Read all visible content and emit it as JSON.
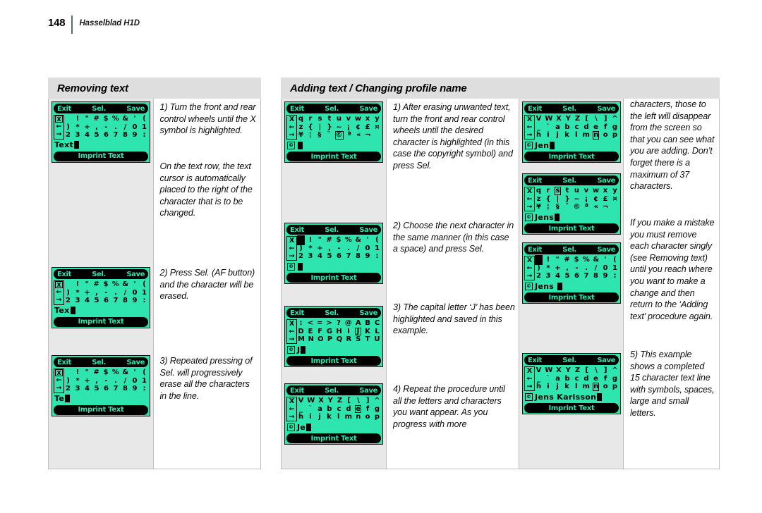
{
  "header": {
    "page_number": "148",
    "title": "Hasselblad H1D"
  },
  "sections": {
    "left": {
      "title": "Removing text"
    },
    "right": {
      "title": "Adding text / Changing profile name"
    }
  },
  "lcd_labels": {
    "exit": "Exit",
    "sel": "Sel.",
    "save": "Save",
    "imprint": "Imprint Text",
    "arrow_x": "X",
    "arrow_left": "←",
    "arrow_right": "→",
    "copyright_prefix": "©"
  },
  "screens": {
    "l1": {
      "name": "removing-text-screen-1",
      "arrow_top_boxed": true,
      "rows": [
        [
          "",
          "!",
          "\"",
          "#",
          "$",
          "%",
          "&",
          "'",
          "("
        ],
        [
          ")",
          "*",
          "+",
          ",",
          "-",
          ".",
          "/",
          "0",
          "1"
        ],
        [
          "2",
          "3",
          "4",
          "5",
          "6",
          "7",
          "8",
          "9",
          ":"
        ]
      ],
      "selected": null,
      "text_prefix": "",
      "text_value": "Text",
      "cursor": true
    },
    "l2": {
      "name": "removing-text-screen-2",
      "arrow_top_boxed": true,
      "rows": [
        [
          "",
          "!",
          "\"",
          "#",
          "$",
          "%",
          "&",
          "'",
          "("
        ],
        [
          ")",
          "*",
          "+",
          ",",
          "-",
          ".",
          "/",
          "0",
          "1"
        ],
        [
          "2",
          "3",
          "4",
          "5",
          "6",
          "7",
          "8",
          "9",
          ":"
        ]
      ],
      "selected": null,
      "text_prefix": "",
      "text_value": "Tex",
      "cursor": true
    },
    "l3": {
      "name": "removing-text-screen-3",
      "arrow_top_boxed": true,
      "rows": [
        [
          "",
          "!",
          "\"",
          "#",
          "$",
          "%",
          "&",
          "'",
          "("
        ],
        [
          ")",
          "*",
          "+",
          ",",
          "-",
          ".",
          "/",
          "0",
          "1"
        ],
        [
          "2",
          "3",
          "4",
          "5",
          "6",
          "7",
          "8",
          "9",
          ":"
        ]
      ],
      "selected": null,
      "text_prefix": "",
      "text_value": "Te",
      "cursor": true
    },
    "m1": {
      "name": "adding-text-screen-1",
      "arrow_top_boxed": false,
      "rows": [
        [
          "q",
          "r",
          "s",
          "t",
          "u",
          "v",
          "w",
          "x",
          "y"
        ],
        [
          "z",
          "{",
          "|",
          "}",
          "~",
          "¡",
          "¢",
          "£",
          "¤"
        ],
        [
          "¥",
          "¦",
          "§",
          "¨",
          "©",
          "ª",
          "«",
          "¬",
          ""
        ]
      ],
      "selected": [
        2,
        4
      ],
      "text_prefix": "©",
      "text_value": "",
      "cursor": true
    },
    "m2": {
      "name": "adding-text-screen-2",
      "arrow_top_boxed": false,
      "rows": [
        [
          " ",
          "!",
          "\"",
          "#",
          "$",
          "%",
          "&",
          "'",
          "("
        ],
        [
          ")",
          "*",
          "+",
          ",",
          "-",
          ".",
          "/",
          "0",
          "1"
        ],
        [
          "2",
          "3",
          "4",
          "5",
          "6",
          "7",
          "8",
          "9",
          ":"
        ]
      ],
      "selected": [
        0,
        0
      ],
      "text_prefix": "©",
      "text_value": "",
      "cursor": true
    },
    "m3": {
      "name": "adding-text-screen-3",
      "arrow_top_boxed": false,
      "rows": [
        [
          ":",
          "<",
          "=",
          ">",
          "?",
          "@",
          "A",
          "B",
          "C"
        ],
        [
          "D",
          "E",
          "F",
          "G",
          "H",
          "I",
          "J",
          "K",
          "L"
        ],
        [
          "M",
          "N",
          "O",
          "P",
          "Q",
          "R",
          "S",
          "T",
          "U"
        ]
      ],
      "selected": [
        1,
        6
      ],
      "text_prefix": "©",
      "text_value": "J",
      "cursor": true
    },
    "m4": {
      "name": "adding-text-screen-4",
      "arrow_top_boxed": false,
      "rows": [
        [
          "V",
          "W",
          "X",
          "Y",
          "Z",
          "[",
          "\\",
          "]",
          "^"
        ],
        [
          "_",
          "`",
          "a",
          "b",
          "c",
          "d",
          "e",
          "f",
          "g"
        ],
        [
          "h",
          "i",
          "j",
          "k",
          "l",
          "m",
          "n",
          "o",
          "p"
        ]
      ],
      "selected": [
        1,
        6
      ],
      "text_prefix": "©",
      "text_value": "Je",
      "cursor": true
    },
    "r1": {
      "name": "adding-text-screen-5",
      "arrow_top_boxed": false,
      "rows": [
        [
          "V",
          "W",
          "X",
          "Y",
          "Z",
          "[",
          "\\",
          "]",
          "^"
        ],
        [
          "_",
          "`",
          "a",
          "b",
          "c",
          "d",
          "e",
          "f",
          "g"
        ],
        [
          "h",
          "i",
          "j",
          "k",
          "l",
          "m",
          "n",
          "o",
          "p"
        ]
      ],
      "selected": [
        2,
        6
      ],
      "text_prefix": "©",
      "text_value": "Jen",
      "cursor": true
    },
    "r2": {
      "name": "adding-text-screen-6",
      "arrow_top_boxed": false,
      "rows": [
        [
          "q",
          "r",
          "s",
          "t",
          "u",
          "v",
          "w",
          "x",
          "y"
        ],
        [
          "z",
          "{",
          "|",
          "}",
          "~",
          "¡",
          "¢",
          "£",
          "¤"
        ],
        [
          "¥",
          "¦",
          "§",
          "¨",
          "©",
          "ª",
          "«",
          "¬",
          ""
        ]
      ],
      "selected": [
        0,
        2
      ],
      "text_prefix": "©",
      "text_value": "Jens",
      "cursor": true
    },
    "r3": {
      "name": "adding-text-screen-7",
      "arrow_top_boxed": false,
      "rows": [
        [
          " ",
          "!",
          "\"",
          "#",
          "$",
          "%",
          "&",
          "'",
          "("
        ],
        [
          ")",
          "*",
          "+",
          ",",
          "-",
          ".",
          "/",
          "0",
          "1"
        ],
        [
          "2",
          "3",
          "4",
          "5",
          "6",
          "7",
          "8",
          "9",
          ":"
        ]
      ],
      "selected": [
        0,
        0
      ],
      "text_prefix": "©",
      "text_value": "Jens ",
      "cursor": true
    },
    "r4": {
      "name": "adding-text-screen-8",
      "arrow_top_boxed": false,
      "rows": [
        [
          "V",
          "W",
          "X",
          "Y",
          "Z",
          "[",
          "\\",
          "]",
          "^"
        ],
        [
          "_",
          "`",
          "a",
          "b",
          "c",
          "d",
          "e",
          "f",
          "g"
        ],
        [
          "h",
          "i",
          "j",
          "k",
          "l",
          "m",
          "n",
          "o",
          "p"
        ]
      ],
      "selected": [
        2,
        6
      ],
      "text_prefix": "©",
      "text_value": "Jens Karlsson",
      "cursor": true
    }
  },
  "instructions": {
    "left": {
      "t1": "1)  Turn the front and rear control wheels until the X symbol is highlighted.",
      "t2": "On the text row, the text cursor is automatically placed to the right of the character that is to be changed.",
      "t3": "2)  Press Sel. (AF button) and the character will be erased.",
      "t4": "3)  Repeated pressing of Sel. will progressively erase all the characters in the line."
    },
    "middle": {
      "t1": "1)  After erasing unwanted text, turn the front and rear control wheels until the desired character is highlighted (in this case the copyright symbol) and press Sel.",
      "t2": "2)  Choose the next character in the same manner (in this case a space) and press Sel.",
      "t3": "3)  The capital letter ‘J’ has been highlighted and saved in this example.",
      "t4": "4)  Repeat the procedure until all the letters and characters you want appear. As you progress with more"
    },
    "right": {
      "t1": "characters, those to the left will disappear from the screen so that you can see what you are adding. Don’t forget there is a maximum of 37 characters.",
      "t2": "If you make a mistake you must remove each character singly (see Removing text) until you reach where you want to make a change and then return to the ‘Adding text’ procedure again.",
      "t3": "5)  This example shows a completed 15 character text line with symbols, spaces, large and small letters."
    }
  }
}
